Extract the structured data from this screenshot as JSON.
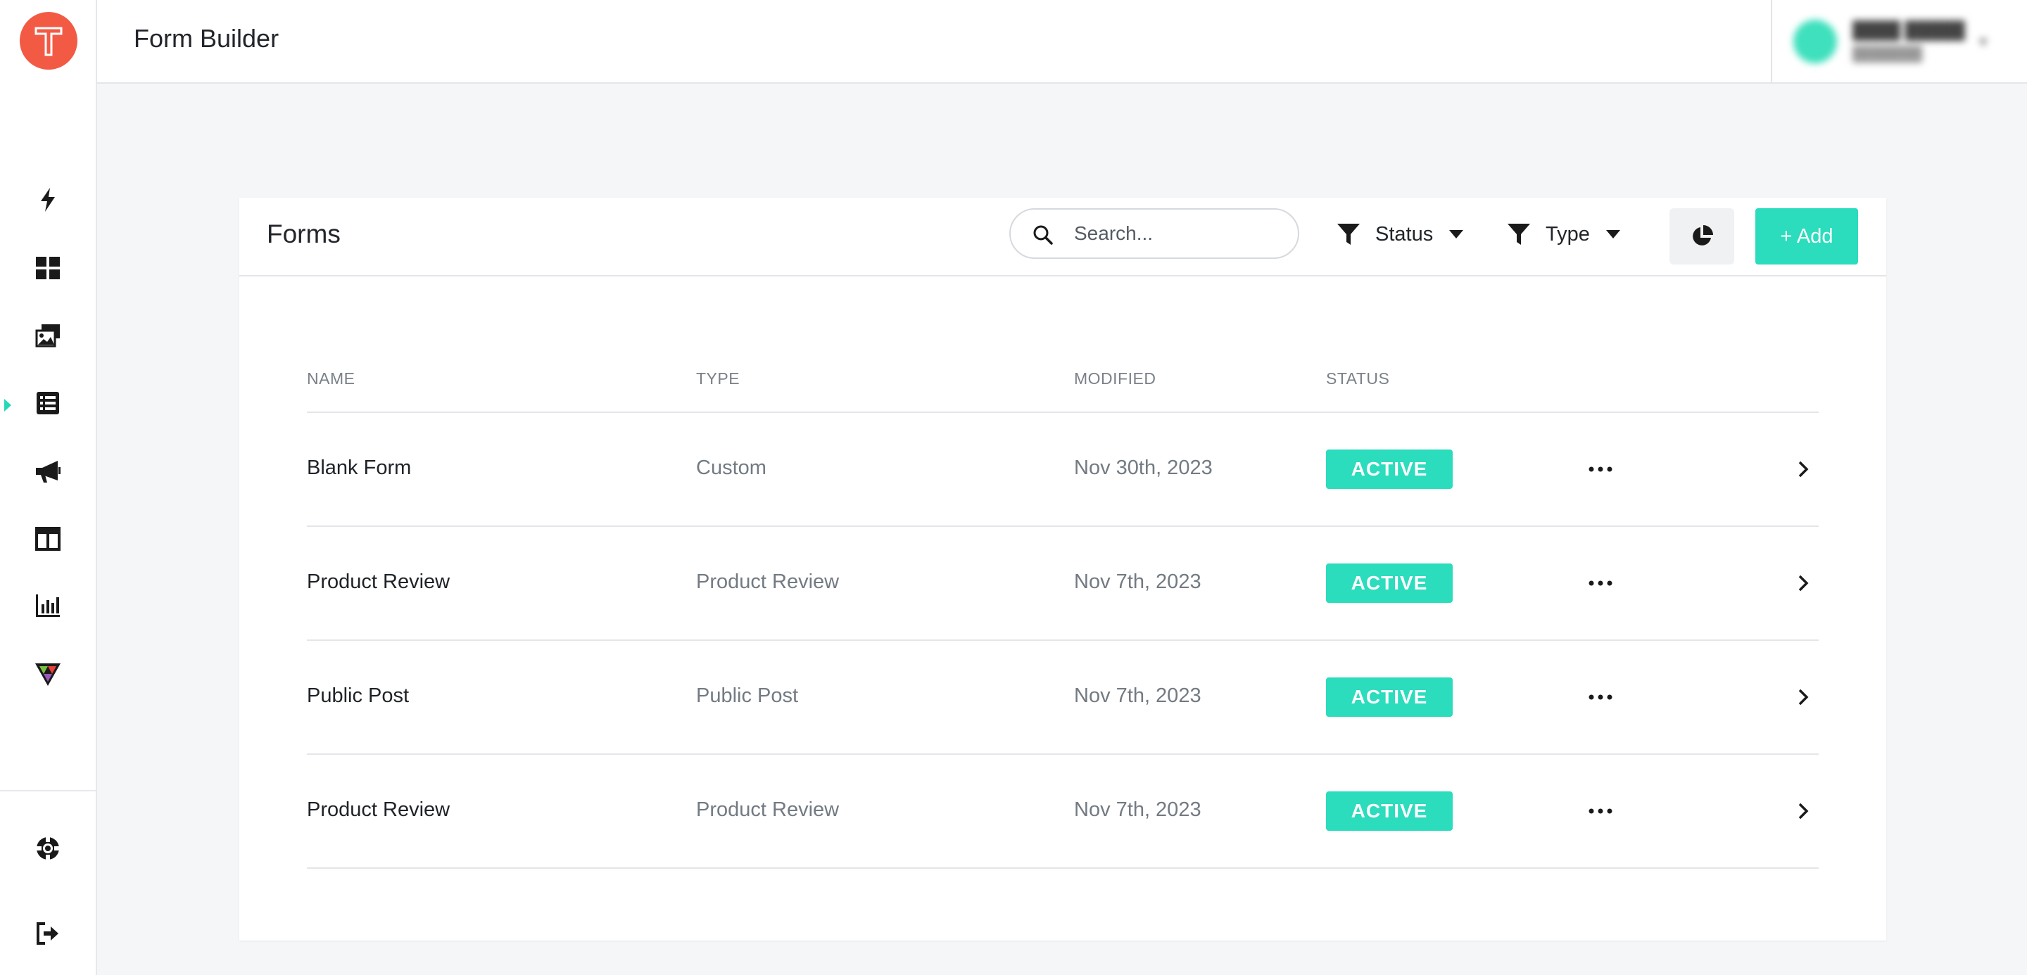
{
  "app": {
    "title": "Form Builder",
    "accent_color": "#2bdcbd",
    "logo_color": "#f25a44"
  },
  "sidebar": {
    "items": [
      {
        "name": "lightning-icon",
        "active": false
      },
      {
        "name": "dashboard-grid-icon",
        "active": false
      },
      {
        "name": "media-gallery-icon",
        "active": false
      },
      {
        "name": "forms-list-icon",
        "active": true
      },
      {
        "name": "megaphone-icon",
        "active": false
      },
      {
        "name": "layout-columns-icon",
        "active": false
      },
      {
        "name": "bar-chart-icon",
        "active": false
      },
      {
        "name": "brand-v-icon",
        "active": false
      }
    ],
    "bottom_items": [
      {
        "name": "help-lifebuoy-icon"
      },
      {
        "name": "logout-icon"
      }
    ]
  },
  "card": {
    "title": "Forms",
    "search_placeholder": "Search...",
    "filters": [
      {
        "label": "Status"
      },
      {
        "label": "Type"
      }
    ],
    "add_label": "+ Add"
  },
  "table": {
    "columns": [
      "NAME",
      "TYPE",
      "MODIFIED",
      "STATUS"
    ],
    "rows": [
      {
        "name": "Blank Form",
        "type": "Custom",
        "modified": "Nov 30th, 2023",
        "status": "ACTIVE"
      },
      {
        "name": "Product Review",
        "type": "Product Review",
        "modified": "Nov 7th, 2023",
        "status": "ACTIVE"
      },
      {
        "name": "Public Post",
        "type": "Public Post",
        "modified": "Nov 7th, 2023",
        "status": "ACTIVE"
      },
      {
        "name": "Product Review",
        "type": "Product Review",
        "modified": "Nov 7th, 2023",
        "status": "ACTIVE"
      }
    ]
  }
}
